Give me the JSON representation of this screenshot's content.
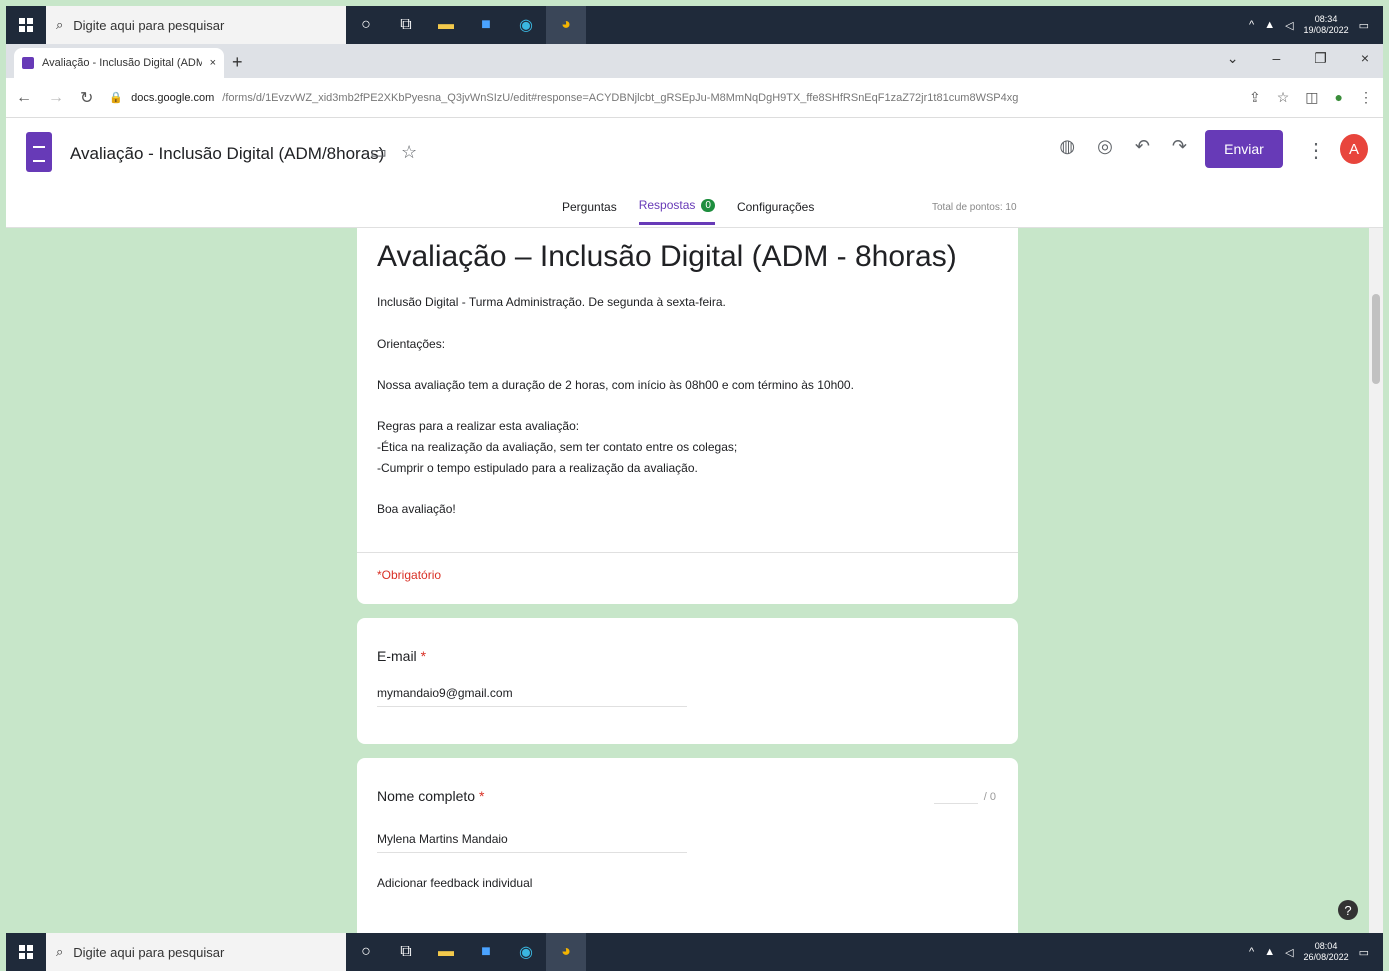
{
  "taskbar": {
    "search_placeholder": "Digite aqui para pesquisar",
    "top_date": "19/08/2022",
    "top_time": "08:34",
    "bottom_date": "26/08/2022",
    "bottom_time": "08:04"
  },
  "browser": {
    "tab_title": "Avaliação - Inclusão Digital (ADM",
    "url_host": "docs.google.com",
    "url_path": "/forms/d/1EvzvWZ_xid3mb2fPE2XKbPyesna_Q3jvWnSIzU/edit#response=ACYDBNjlcbt_gRSEpJu-M8MmNqDgH9TX_ffe8SHfRSnEqF1zaZ72jr1t81cum8WSP4xg"
  },
  "header": {
    "form_name": "Avaliação - Inclusão Digital (ADM/8horas)",
    "send_label": "Enviar",
    "avatar_letter": "A"
  },
  "tabs": {
    "questions": "Perguntas",
    "responses": "Respostas",
    "responses_count": "0",
    "settings": "Configurações",
    "total_points": "Total de pontos: 10"
  },
  "form": {
    "title": "Avaliação –  Inclusão Digital (ADM - 8horas)",
    "description_1": "Inclusão Digital  - Turma Administração. De segunda à sexta-feira.",
    "description_2": "Orientações:",
    "description_3": "Nossa avaliação tem a duração de  2 horas, com início às 08h00 e com término às 10h00.",
    "description_4": "Regras para a realizar esta avaliação:",
    "description_5": "-Ética na realização da avaliação, sem ter contato entre os colegas;",
    "description_6": "-Cumprir o tempo estipulado para a realização da avaliação.",
    "description_7": "Boa avaliação!",
    "required_note": "*Obrigatório"
  },
  "questions": [
    {
      "label": "E-mail",
      "answer": "mymandaio9@gmail.com"
    },
    {
      "label": "Nome completo",
      "answer": "Mylena Martins Mandaio",
      "points": "/ 0",
      "feedback": "Adicionar feedback individual"
    }
  ]
}
